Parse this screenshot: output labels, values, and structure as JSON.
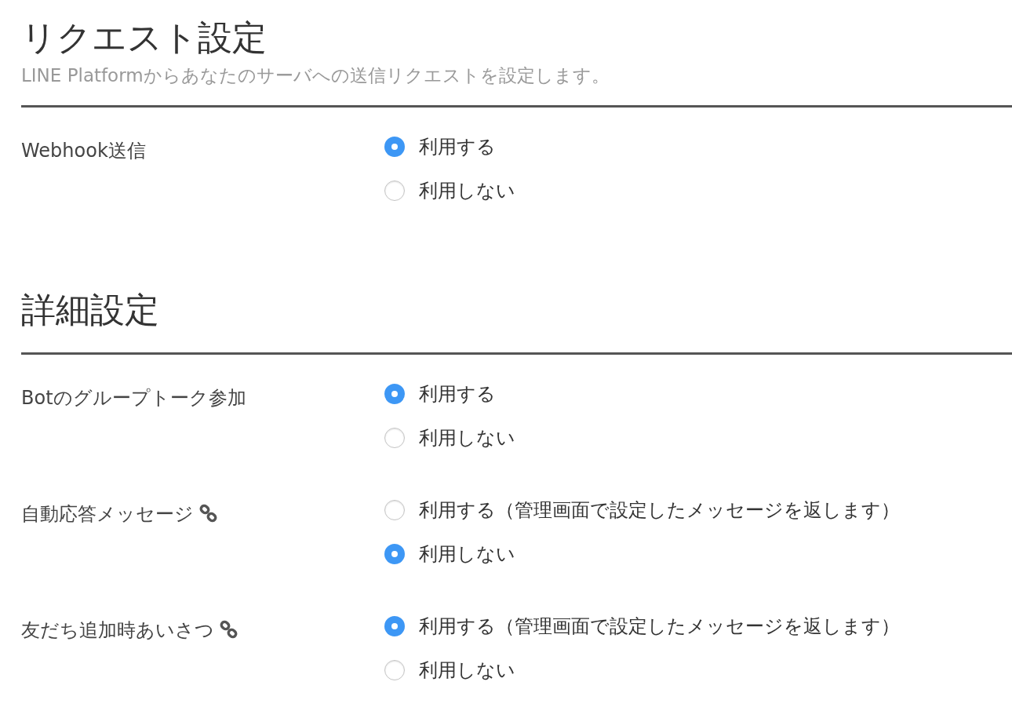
{
  "sections": [
    {
      "title": "リクエスト設定",
      "description": "LINE Platformからあなたのサーバへの送信リクエストを設定します。",
      "rows": [
        {
          "label": "Webhook送信",
          "has_link": false,
          "options": [
            {
              "label": "利用する",
              "selected": true
            },
            {
              "label": "利用しない",
              "selected": false
            }
          ]
        }
      ]
    },
    {
      "title": "詳細設定",
      "rows": [
        {
          "label": "Botのグループトーク参加",
          "has_link": false,
          "options": [
            {
              "label": "利用する",
              "selected": true
            },
            {
              "label": "利用しない",
              "selected": false
            }
          ]
        },
        {
          "label": "自動応答メッセージ",
          "has_link": true,
          "options": [
            {
              "label": "利用する（管理画面で設定したメッセージを返します）",
              "selected": false
            },
            {
              "label": "利用しない",
              "selected": true
            }
          ]
        },
        {
          "label": "友だち追加時あいさつ",
          "has_link": true,
          "options": [
            {
              "label": "利用する（管理画面で設定したメッセージを返します）",
              "selected": true
            },
            {
              "label": "利用しない",
              "selected": false
            }
          ]
        }
      ]
    }
  ]
}
